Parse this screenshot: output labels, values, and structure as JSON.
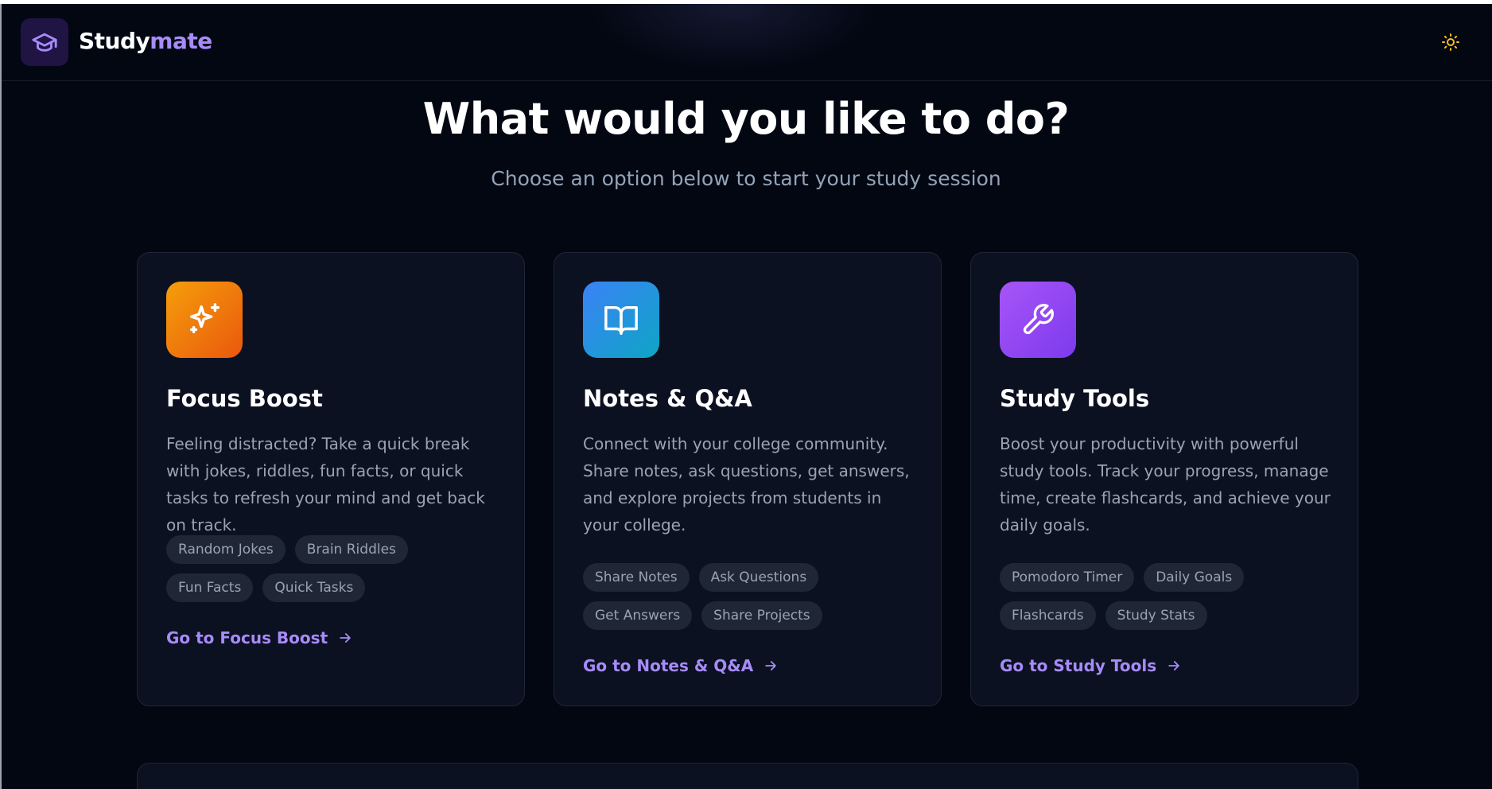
{
  "brand": {
    "part1": "Study",
    "part2": "mate",
    "icon": "graduation-cap-icon"
  },
  "header": {
    "theme_toggle_icon": "sun-icon",
    "theme_toggle_color": "#fbbf24"
  },
  "hero": {
    "title": "What would you like to do?",
    "subtitle": "Choose an option below to start your study session"
  },
  "cards": [
    {
      "icon": "sparkles-icon",
      "accent": "#f97316",
      "title": "Focus Boost",
      "description": "Feeling distracted? Take a quick break with jokes, riddles, fun facts, or quick tasks to refresh your mind and get back on track.",
      "tags": [
        "Random Jokes",
        "Brain Riddles",
        "Fun Facts",
        "Quick Tasks"
      ],
      "link": "Go to Focus Boost"
    },
    {
      "icon": "book-open-icon",
      "accent": "#3b82f6",
      "title": "Notes & Q&A",
      "description": "Connect with your college community. Share notes, ask questions, get answers, and explore projects from students in your college.",
      "tags": [
        "Share Notes",
        "Ask Questions",
        "Get Answers",
        "Share Projects"
      ],
      "link": "Go to Notes & Q&A"
    },
    {
      "icon": "wrench-icon",
      "accent": "#a855f7",
      "title": "Study Tools",
      "description": "Boost your productivity with powerful study tools. Track your progress, manage time, create flashcards, and achieve your daily goals.",
      "tags": [
        "Pomodoro Timer",
        "Daily Goals",
        "Flashcards",
        "Study Stats"
      ],
      "link": "Go to Study Tools"
    }
  ],
  "colors": {
    "background": "#030712",
    "card": "#0b1120",
    "link": "#a78bfa",
    "brand_accent": "#a78bfa"
  }
}
